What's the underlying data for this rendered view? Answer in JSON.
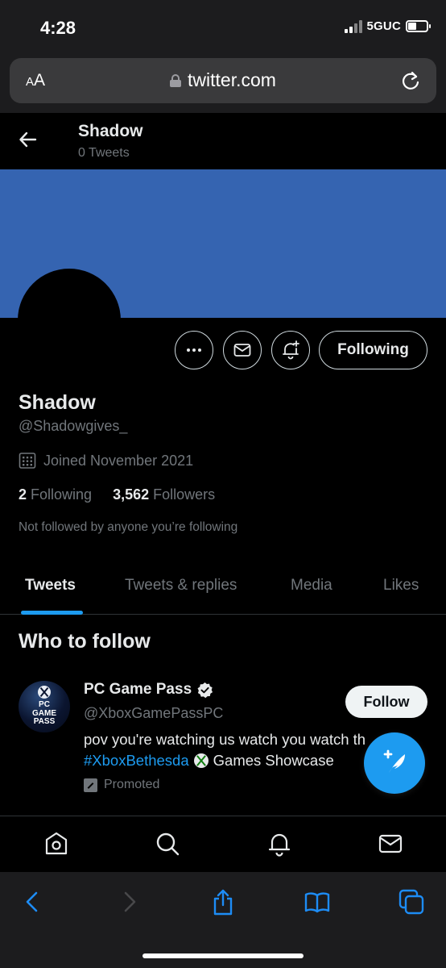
{
  "status_bar": {
    "time": "4:28",
    "network": "5GUC"
  },
  "browser": {
    "aa_label_small": "A",
    "aa_label_large": "A",
    "url": "twitter.com"
  },
  "header": {
    "name": "Shadow",
    "tweet_count": "0 Tweets"
  },
  "profile": {
    "name": "Shadow",
    "handle": "@Shadowgives_",
    "joined": "Joined November 2021",
    "following_count": "2",
    "following_label": "Following",
    "followers_count": "3,562",
    "followers_label": "Followers",
    "not_followed": "Not followed by anyone you’re following",
    "following_button": "Following",
    "banner_color": "#3564b1"
  },
  "tabs": [
    {
      "label": "Tweets",
      "active": true
    },
    {
      "label": "Tweets & replies"
    },
    {
      "label": "Media"
    },
    {
      "label": "Likes"
    }
  ],
  "who_to_follow": {
    "title": "Who to follow",
    "suggestion": {
      "avatar_text": "PC GAME PASS",
      "name": "PC Game Pass",
      "handle": "@XboxGamePassPC",
      "follow_label": "Follow",
      "text_line1": "pov you're watching us watch you watch th",
      "hashtag": "#XboxBethesda",
      "text_line2_rest": "Games Showcase",
      "promoted": "Promoted"
    }
  },
  "colors": {
    "accent": "#1d9bf0",
    "background": "#000000",
    "muted": "#71767b"
  },
  "icons": {
    "back": "arrow-left-icon",
    "more": "more-icon",
    "message": "envelope-icon",
    "notify": "bell-plus-icon",
    "compose": "feather-plus-icon",
    "nav": [
      "home-icon",
      "search-icon",
      "bell-icon",
      "mail-icon"
    ],
    "safari": [
      "back-icon",
      "forward-icon",
      "share-icon",
      "bookmarks-icon",
      "tabs-icon"
    ]
  }
}
